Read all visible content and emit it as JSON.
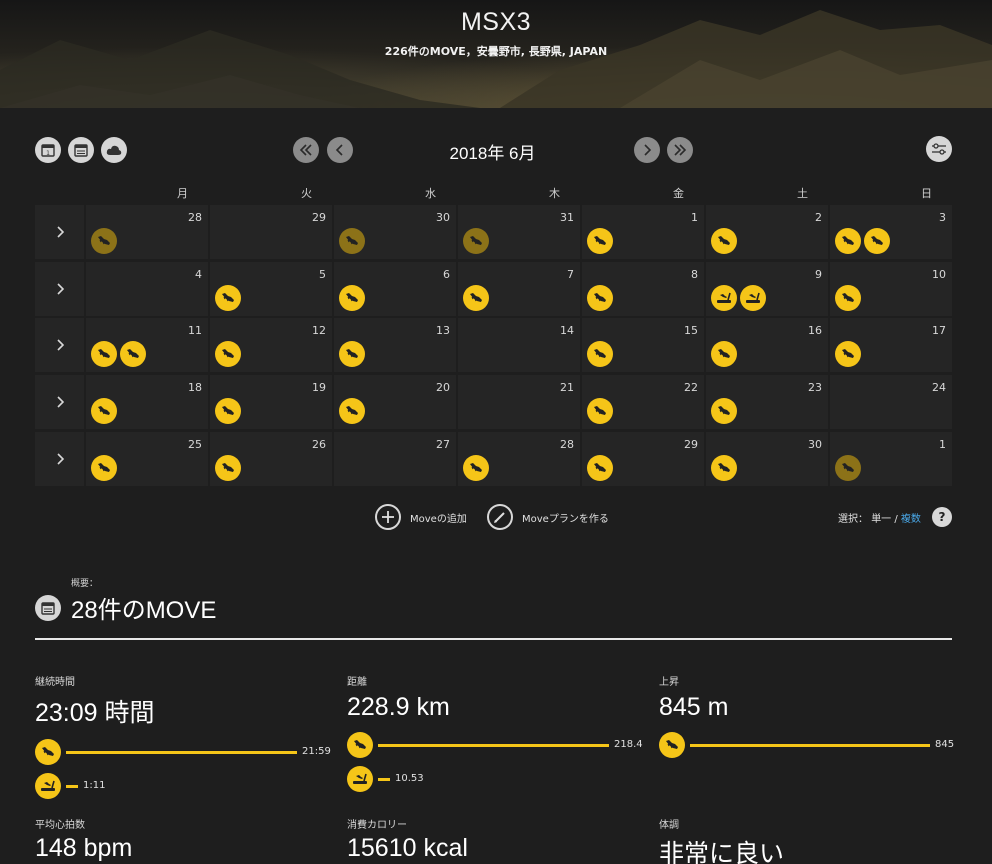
{
  "header": {
    "title": "MSX3",
    "subtitle": "226件のMOVE，安曇野市, 長野県, JAPAN"
  },
  "toolbar": {
    "view_icons": [
      "calendar-month-icon",
      "calendar-list-icon",
      "cloud-icon"
    ],
    "month_label": "2018年 6月",
    "nav_icons": [
      "double-chevron-left-icon",
      "chevron-left-icon",
      "chevron-right-icon",
      "double-chevron-right-icon"
    ],
    "settings_icon": "sliders-icon"
  },
  "calendar": {
    "weekdays": [
      "月",
      "火",
      "水",
      "木",
      "金",
      "土",
      "日"
    ],
    "weeks": [
      {
        "days": [
          {
            "num": "28",
            "moves": [
              "run-dim"
            ]
          },
          {
            "num": "29",
            "moves": []
          },
          {
            "num": "30",
            "moves": [
              "run-dim"
            ]
          },
          {
            "num": "31",
            "moves": [
              "run-dim"
            ]
          },
          {
            "num": "1",
            "moves": [
              "run"
            ]
          },
          {
            "num": "2",
            "moves": [
              "run"
            ]
          },
          {
            "num": "3",
            "moves": [
              "run",
              "run"
            ]
          }
        ]
      },
      {
        "days": [
          {
            "num": "4",
            "moves": []
          },
          {
            "num": "5",
            "moves": [
              "run"
            ]
          },
          {
            "num": "6",
            "moves": [
              "run"
            ]
          },
          {
            "num": "7",
            "moves": [
              "run"
            ]
          },
          {
            "num": "8",
            "moves": [
              "run"
            ]
          },
          {
            "num": "9",
            "moves": [
              "treadmill",
              "treadmill"
            ]
          },
          {
            "num": "10",
            "moves": [
              "run"
            ]
          }
        ]
      },
      {
        "days": [
          {
            "num": "11",
            "moves": [
              "run",
              "run"
            ]
          },
          {
            "num": "12",
            "moves": [
              "run"
            ]
          },
          {
            "num": "13",
            "moves": [
              "run"
            ]
          },
          {
            "num": "14",
            "moves": []
          },
          {
            "num": "15",
            "moves": [
              "run"
            ]
          },
          {
            "num": "16",
            "moves": [
              "run"
            ]
          },
          {
            "num": "17",
            "moves": [
              "run"
            ]
          }
        ]
      },
      {
        "days": [
          {
            "num": "18",
            "moves": [
              "run"
            ]
          },
          {
            "num": "19",
            "moves": [
              "run"
            ]
          },
          {
            "num": "20",
            "moves": [
              "run"
            ]
          },
          {
            "num": "21",
            "moves": []
          },
          {
            "num": "22",
            "moves": [
              "run"
            ]
          },
          {
            "num": "23",
            "moves": [
              "run"
            ]
          },
          {
            "num": "24",
            "moves": []
          }
        ]
      },
      {
        "days": [
          {
            "num": "25",
            "moves": [
              "run"
            ]
          },
          {
            "num": "26",
            "moves": [
              "run"
            ]
          },
          {
            "num": "27",
            "moves": []
          },
          {
            "num": "28",
            "moves": [
              "run"
            ]
          },
          {
            "num": "29",
            "moves": [
              "run"
            ]
          },
          {
            "num": "30",
            "moves": [
              "run"
            ]
          },
          {
            "num": "1",
            "moves": [
              "run-dim"
            ]
          }
        ]
      }
    ]
  },
  "actions": {
    "add_move": "Moveの追加",
    "create_plan": "Moveプランを作る",
    "select_label": "選択：",
    "select_single": "単一",
    "select_sep": " / ",
    "select_multi": "複数",
    "help": "?"
  },
  "summary": {
    "label": "概要：",
    "title": "28件のMOVE",
    "duration": {
      "label": "継続時間",
      "value": "23:09 時間",
      "bars": [
        {
          "icon": "run",
          "value": "21:59",
          "fraction": 1.0
        },
        {
          "icon": "treadmill",
          "value": "1:11",
          "fraction": 0.05
        }
      ]
    },
    "distance": {
      "label": "距離",
      "value": "228.9 km",
      "bars": [
        {
          "icon": "run",
          "value": "218.4",
          "fraction": 1.0
        },
        {
          "icon": "treadmill",
          "value": "10.53",
          "fraction": 0.05
        }
      ]
    },
    "ascent": {
      "label": "上昇",
      "value": "845 m",
      "bars": [
        {
          "icon": "run",
          "value": "845",
          "fraction": 1.0
        }
      ]
    },
    "heart_rate": {
      "label": "平均心拍数",
      "value": "148 bpm"
    },
    "calories": {
      "label": "消費カロリー",
      "value": "15610 kcal"
    },
    "condition": {
      "label": "体調",
      "value": "非常に良い"
    }
  },
  "colors": {
    "accent": "#f5c518",
    "accent_dim": "#8c7218",
    "link": "#4aa8e8",
    "background": "#1e1e1e",
    "cell": "#252525"
  }
}
